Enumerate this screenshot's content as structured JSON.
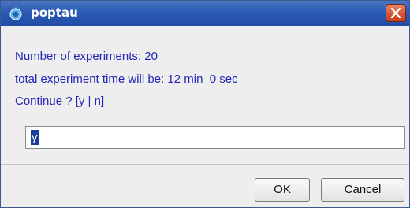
{
  "window": {
    "title": "poptau"
  },
  "dialog": {
    "lines": [
      "Number of experiments: 20",
      "total experiment time will be: 12 min  0 sec",
      "Continue ? [y | n]"
    ],
    "input_value": "y"
  },
  "buttons": {
    "ok": "OK",
    "cancel": "Cancel"
  },
  "icons": {
    "app": "app-icon",
    "close": "close-icon"
  },
  "colors": {
    "titlebar": "#2a59b3",
    "message_text": "#2525b8",
    "close_button": "#d65a38",
    "selection": "#1b3c9a"
  }
}
